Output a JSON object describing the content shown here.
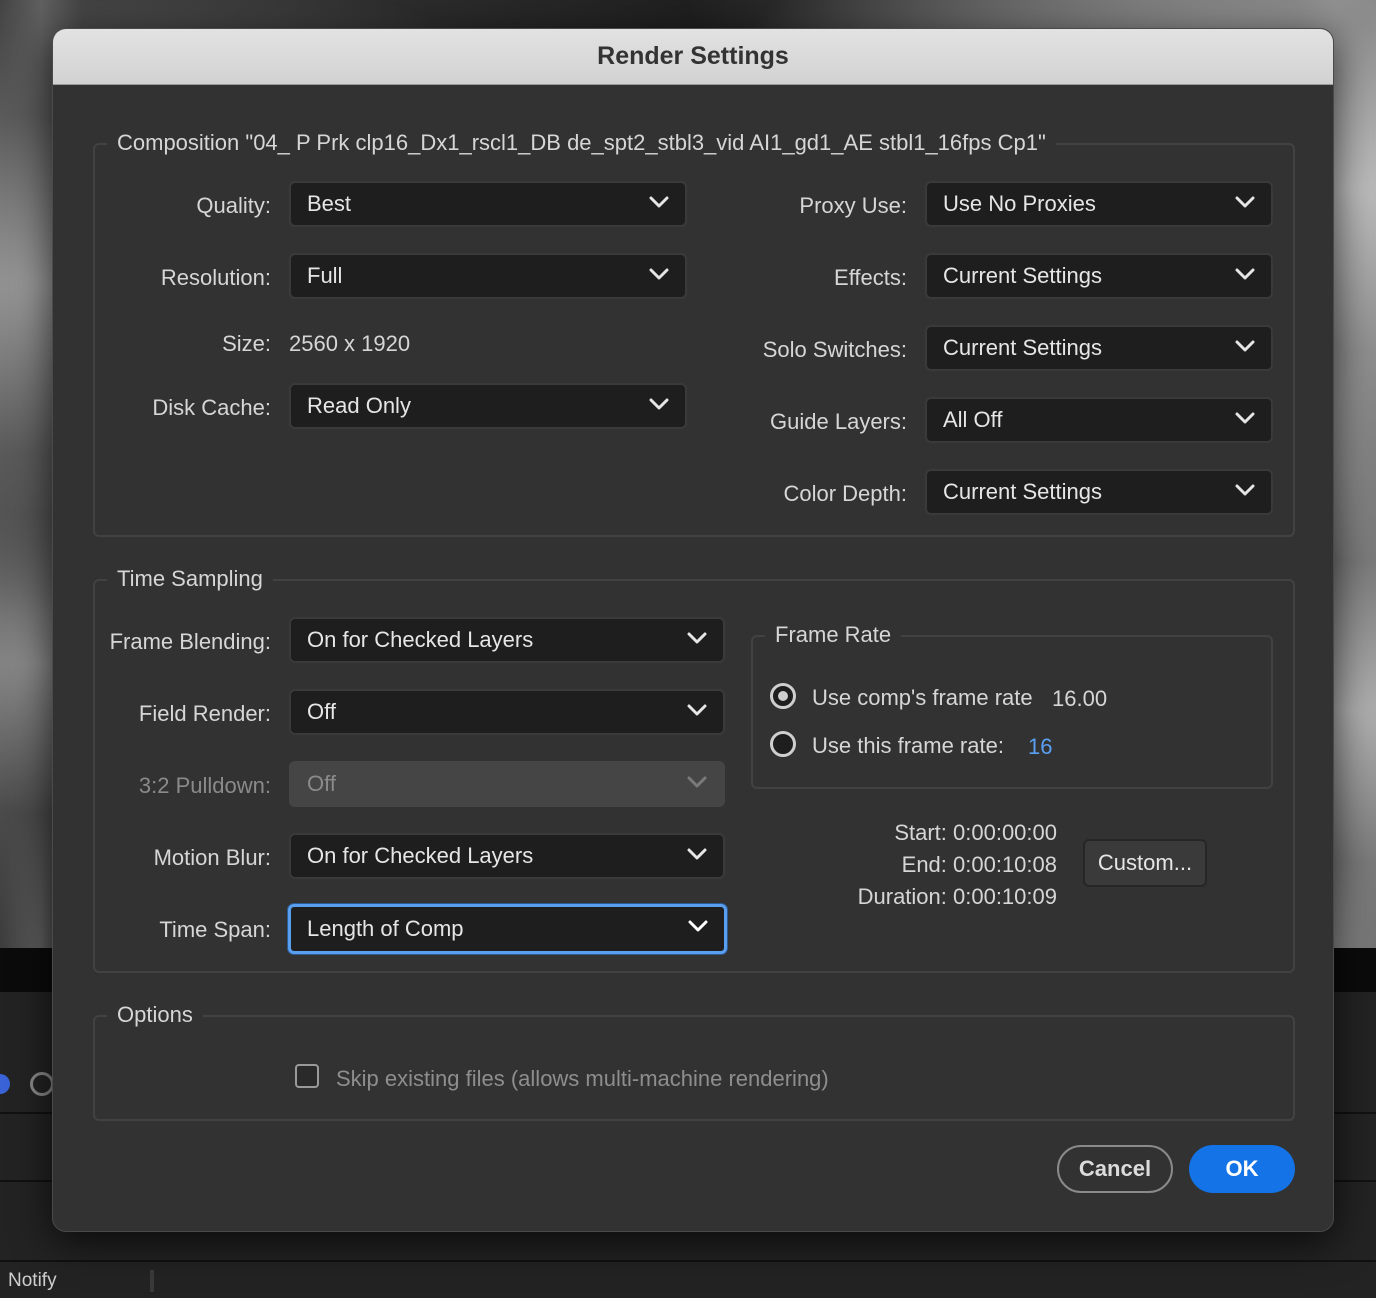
{
  "background": {
    "status_label": "Notify"
  },
  "dialog": {
    "title": "Render Settings",
    "composition": {
      "group_title": "Composition \"04_ P Prk clp16_Dx1_rscl1_DB de_spt2_stbl3_vid AI1_gd1_AE stbl1_16fps Cp1\"",
      "quality": {
        "label": "Quality:",
        "value": "Best"
      },
      "resolution": {
        "label": "Resolution:",
        "value": "Full"
      },
      "size": {
        "label": "Size:",
        "value": "2560 x 1920"
      },
      "disk_cache": {
        "label": "Disk Cache:",
        "value": "Read Only"
      },
      "proxy_use": {
        "label": "Proxy Use:",
        "value": "Use No Proxies"
      },
      "effects": {
        "label": "Effects:",
        "value": "Current Settings"
      },
      "solo_switches": {
        "label": "Solo Switches:",
        "value": "Current Settings"
      },
      "guide_layers": {
        "label": "Guide Layers:",
        "value": "All Off"
      },
      "color_depth": {
        "label": "Color Depth:",
        "value": "Current Settings"
      }
    },
    "time_sampling": {
      "group_title": "Time Sampling",
      "frame_blending": {
        "label": "Frame Blending:",
        "value": "On for Checked Layers"
      },
      "field_render": {
        "label": "Field Render:",
        "value": "Off"
      },
      "pulldown": {
        "label": "3:2 Pulldown:",
        "value": "Off",
        "disabled": true
      },
      "motion_blur": {
        "label": "Motion Blur:",
        "value": "On for Checked Layers"
      },
      "time_span": {
        "label": "Time Span:",
        "value": "Length of Comp"
      },
      "frame_rate": {
        "group_title": "Frame Rate",
        "use_comp_label": "Use comp's frame rate",
        "use_comp_value": "16.00",
        "use_this_label": "Use this frame rate:",
        "use_this_value": "16",
        "selected": "use_comp"
      },
      "start": "Start: 0:00:00:00",
      "end": "End: 0:00:10:08",
      "duration": "Duration: 0:00:10:09",
      "custom_button": "Custom..."
    },
    "options": {
      "group_title": "Options",
      "skip_existing_label": "Skip existing files (allows multi-machine rendering)",
      "skip_existing_checked": false
    },
    "buttons": {
      "cancel": "Cancel",
      "ok": "OK"
    },
    "colors": {
      "accent": "#1473e6",
      "focus_ring": "#5a9ef0",
      "dialog_bg": "#323232",
      "field_bg": "#1e1e1e"
    }
  }
}
